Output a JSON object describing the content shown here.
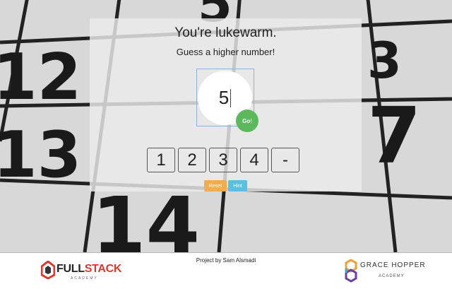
{
  "game": {
    "status": "You're lukewarm.",
    "hint_text": "Guess a higher number!",
    "current_guess": "5",
    "go_label": "Go!",
    "guesses": [
      "1",
      "2",
      "3",
      "4",
      "-"
    ],
    "reset_label": "Reset",
    "hint_label": "Hint"
  },
  "footer": {
    "credit": "Project by Sam Alsmadi",
    "fullstack_logo": {
      "full": "FULL",
      "stack": "STACK",
      "sub": "ACADEMY"
    },
    "gracehopper_logo": {
      "name": "GRACE HOPPER",
      "sub": "ACADEMY"
    }
  },
  "colors": {
    "go": "#5cb85c",
    "reset": "#f0ad4e",
    "hint": "#5bc0de",
    "fullstack_red": "#e0362e"
  }
}
